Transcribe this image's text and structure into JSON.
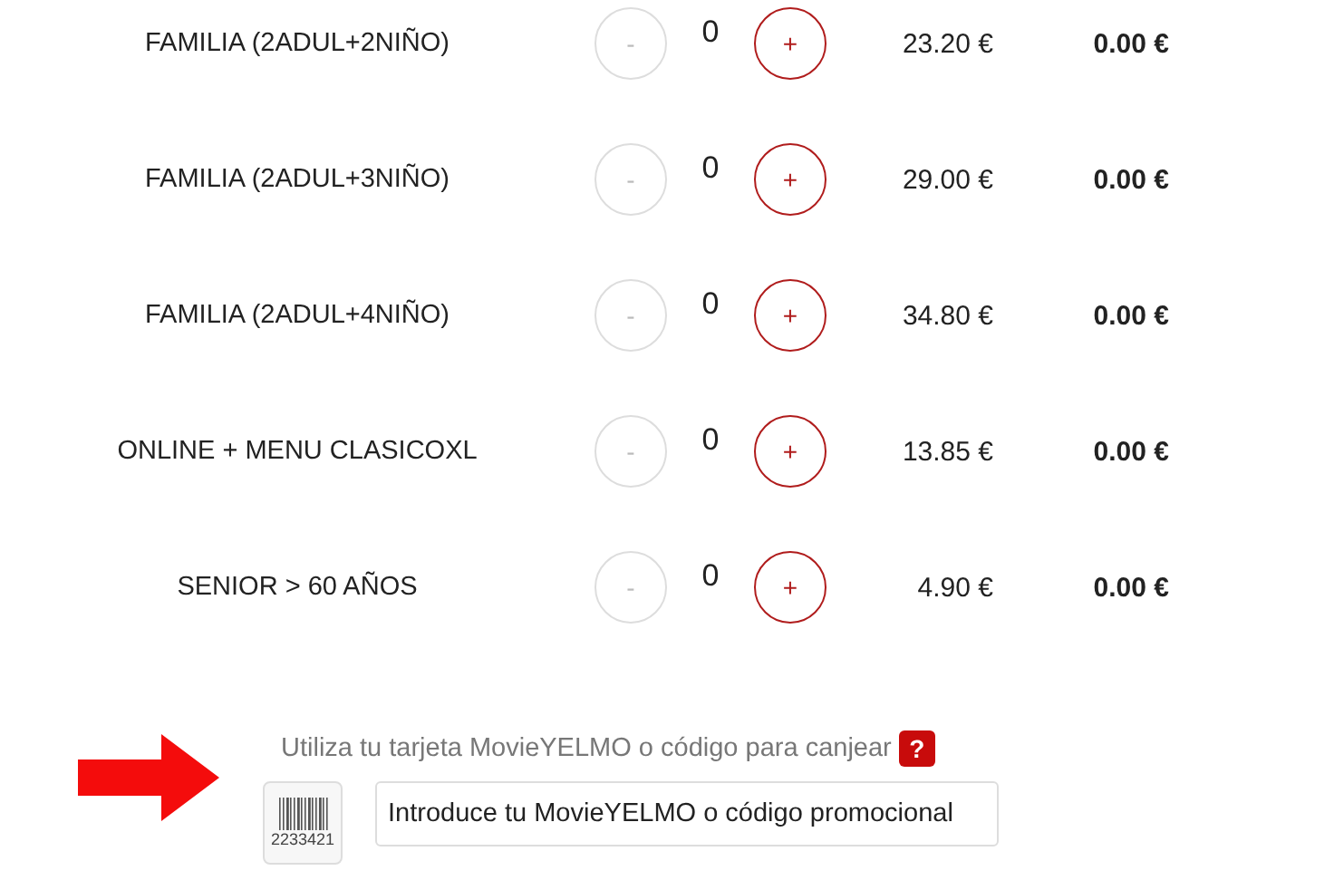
{
  "tickets": [
    {
      "name": "FAMILIA (2ADUL+2NIÑO)",
      "minus": "-",
      "minus_disabled": true,
      "count": "0",
      "plus": "+",
      "plus_disabled": false,
      "price": "23.20 €",
      "total": "0.00 €"
    },
    {
      "name": "FAMILIA (2ADUL+3NIÑO)",
      "minus": "-",
      "minus_disabled": true,
      "count": "0",
      "plus": "+",
      "plus_disabled": false,
      "price": "29.00 €",
      "total": "0.00 €"
    },
    {
      "name": "FAMILIA (2ADUL+4NIÑO)",
      "minus": "-",
      "minus_disabled": true,
      "count": "0",
      "plus": "+",
      "plus_disabled": false,
      "price": "34.80 €",
      "total": "0.00 €"
    },
    {
      "name": "ONLINE + MENU CLASICOXL",
      "minus": "-",
      "minus_disabled": true,
      "count": "0",
      "plus": "+",
      "plus_disabled": false,
      "price": "13.85 €",
      "total": "0.00 €"
    },
    {
      "name": "SENIOR > 60 AÑOS",
      "minus": "-",
      "minus_disabled": true,
      "count": "0",
      "plus": "+",
      "plus_disabled": false,
      "price": "4.90 €",
      "total": "0.00 €"
    }
  ],
  "promo": {
    "hint": "Utiliza tu tarjeta MovieYELMO o código para canjear",
    "help": "?",
    "card_number": "2233421",
    "placeholder": "Introduce tu MovieYELMO o código promocional"
  }
}
